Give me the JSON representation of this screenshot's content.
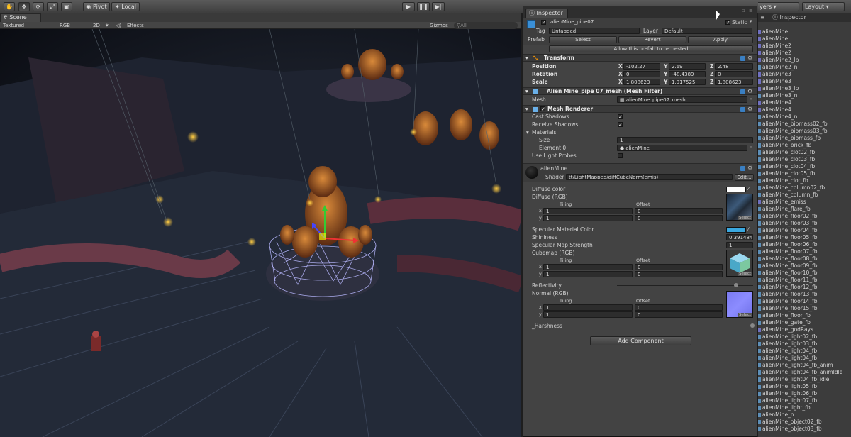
{
  "toolbar": {
    "pivot_label": "Pivot",
    "local_label": "Local",
    "layers_label": "yers",
    "layout_label": "Layout"
  },
  "scene": {
    "tab_label": "Scene",
    "render_mode": "Textured",
    "color_mode": "RGB",
    "mode_2d": "2D",
    "effects_label": "Effects",
    "gizmos_label": "Gizmos",
    "search_placeholder": "All"
  },
  "inspector": {
    "tab_label": "Inspector",
    "object_name": "alienMine_pipe07",
    "static_label": "Static",
    "tag_label": "Tag",
    "tag_value": "Untagged",
    "layer_label": "Layer",
    "layer_value": "Default",
    "prefab_label": "Prefab",
    "prefab_select": "Select",
    "prefab_revert": "Revert",
    "prefab_apply": "Apply",
    "prefab_nested": "Allow this prefab to be nested",
    "transform": {
      "title": "Transform",
      "position_label": "Position",
      "rotation_label": "Rotation",
      "scale_label": "Scale",
      "position": {
        "x": "-102.27",
        "y": "2.69",
        "z": "2.48"
      },
      "rotation": {
        "x": "0",
        "y": "-48.4389",
        "z": "0"
      },
      "scale": {
        "x": "1.808623",
        "y": "1.017525",
        "z": "1.808623"
      }
    },
    "mesh_filter": {
      "title": "Alien Mine_pipe 07_mesh (Mesh Filter)",
      "mesh_label": "Mesh",
      "mesh_value": "alienMine_pipe07_mesh"
    },
    "mesh_renderer": {
      "title": "Mesh Renderer",
      "cast_shadows": "Cast Shadows",
      "receive_shadows": "Receive Shadows",
      "materials": "Materials",
      "size_label": "Size",
      "size_value": "1",
      "element0_label": "Element 0",
      "element0_value": "alienMine",
      "light_probes": "Use Light Probes"
    },
    "material": {
      "name": "alienMine",
      "shader_label": "Shader",
      "shader_value": "tt/LightMapped/diffCubeNorm(emis)",
      "edit_label": "Edit...",
      "diffuse_color": "Diffuse color",
      "diffuse_rgb": "Diffuse (RGB)",
      "tiling_label": "Tiling",
      "offset_label": "Offset",
      "x_label": "x",
      "y_label": "y",
      "select_label": "Select",
      "diffuse_tiling_x": "1",
      "diffuse_tiling_y": "1",
      "diffuse_offset_x": "0",
      "diffuse_offset_y": "0",
      "specular_color": "Specular Material Color",
      "shininess_label": "Shininess",
      "shininess_value": "0.3914843",
      "spec_strength_label": "Specular Map Strength",
      "spec_strength_value": "1",
      "cubemap_label": "Cubemap (RGB)",
      "cube_tiling_x": "1",
      "cube_tiling_y": "1",
      "cube_offset_x": "0",
      "cube_offset_y": "0",
      "reflectivity_label": "Reflectivity",
      "normal_label": "Normal (RGB)",
      "normal_tiling_x": "1",
      "normal_tiling_y": "1",
      "normal_offset_x": "0",
      "normal_offset_y": "0",
      "harshness_label": "_Harshness",
      "diffuse_color_hex": "#ffffff",
      "specular_color_hex": "#3aa8e0"
    },
    "add_component": "Add Component"
  },
  "project": {
    "tab_inspector": "Inspector",
    "items": [
      "alienMine",
      "alienMine",
      "alienMine2",
      "alienMine2",
      "alienMine2_lp",
      "alienMine2_n",
      "alienMine3",
      "alienMine3",
      "alienMine3_lp",
      "alienMine3_n",
      "alienMine4",
      "alienMine4",
      "alienMine4_n",
      "alienMine_biomass02_fb",
      "alienMine_biomass03_fb",
      "alienMine_biomass_fb",
      "alienMine_brick_fb",
      "alienMine_clot02_fb",
      "alienMine_clot03_fb",
      "alienMine_clot04_fb",
      "alienMine_clot05_fb",
      "alienMine_clot_fb",
      "alienMine_column02_fb",
      "alienMine_column_fb",
      "alienMine_emiss",
      "alienMine_flare_fb",
      "alienMine_floor02_fb",
      "alienMine_floor03_fb",
      "alienMine_floor04_fb",
      "alienMine_floor05_fb",
      "alienMine_floor06_fb",
      "alienMine_floor07_fb",
      "alienMine_floor08_fb",
      "alienMine_floor09_fb",
      "alienMine_floor10_fb",
      "alienMine_floor11_fb",
      "alienMine_floor12_fb",
      "alienMine_floor13_fb",
      "alienMine_floor14_fb",
      "alienMine_floor15_fb",
      "alienMine_floor_fb",
      "alienMine_gate_fb",
      "alienMine_godRays",
      "alienMine_light02_fb",
      "alienMine_light03_fb",
      "alienMine_light04_fb",
      "alienMine_light04_fb",
      "alienMine_light04_fb_anim",
      "alienMine_light04_fb_animIdle",
      "alienMine_light04_fb_idle",
      "alienMine_light05_fb",
      "alienMine_light06_fb",
      "alienMine_light07_fb",
      "alienMine_light_fb",
      "alienMine_n",
      "alienMine_object02_fb",
      "alienMine_object03_fb"
    ]
  }
}
